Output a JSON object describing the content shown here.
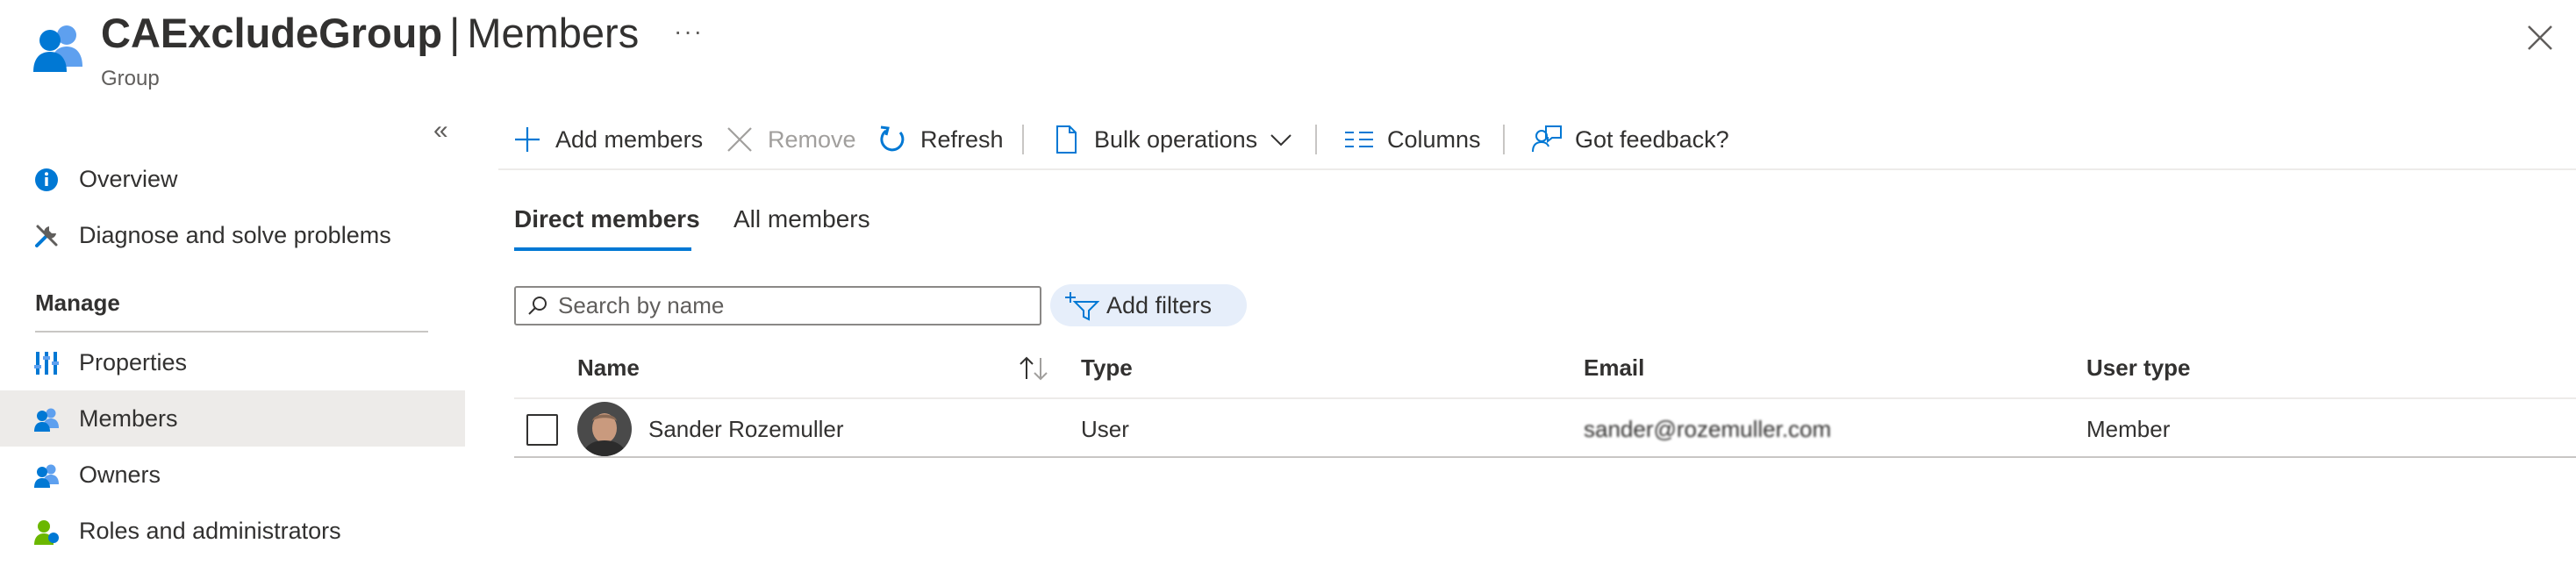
{
  "header": {
    "title": "CAExcludeGroup",
    "separator": "|",
    "subtitle": "Members",
    "more_label": "···",
    "resource_type": "Group"
  },
  "sidebar": {
    "collapse_label": "«",
    "items": [
      {
        "label": "Overview",
        "icon": "info-icon"
      },
      {
        "label": "Diagnose and solve problems",
        "icon": "wrench-icon"
      }
    ],
    "section_label": "Manage",
    "manage_items": [
      {
        "label": "Properties",
        "icon": "properties-icon"
      },
      {
        "label": "Members",
        "icon": "members-icon",
        "active": true
      },
      {
        "label": "Owners",
        "icon": "owners-icon"
      },
      {
        "label": "Roles and administrators",
        "icon": "roles-icon"
      }
    ]
  },
  "toolbar": {
    "add_members": "Add members",
    "remove": "Remove",
    "refresh": "Refresh",
    "bulk_operations": "Bulk operations",
    "columns": "Columns",
    "feedback": "Got feedback?"
  },
  "tabs": [
    {
      "label": "Direct members",
      "active": true
    },
    {
      "label": "All members",
      "active": false
    }
  ],
  "search": {
    "placeholder": "Search by name",
    "value": ""
  },
  "filters": {
    "add_filters_label": "Add filters"
  },
  "table": {
    "columns": [
      "Name",
      "Type",
      "Email",
      "User type"
    ],
    "sort_column": "Name",
    "rows": [
      {
        "name": "Sander Rozemuller",
        "type": "User",
        "email": "sander@rozemuller.com",
        "user_type": "Member",
        "selected": false
      }
    ]
  },
  "colors": {
    "accent": "#0078d4",
    "active_nav_bg": "#edebe9",
    "filter_pill_bg": "#e6eefa",
    "text": "#323130",
    "disabled_text": "#a19f9d"
  }
}
